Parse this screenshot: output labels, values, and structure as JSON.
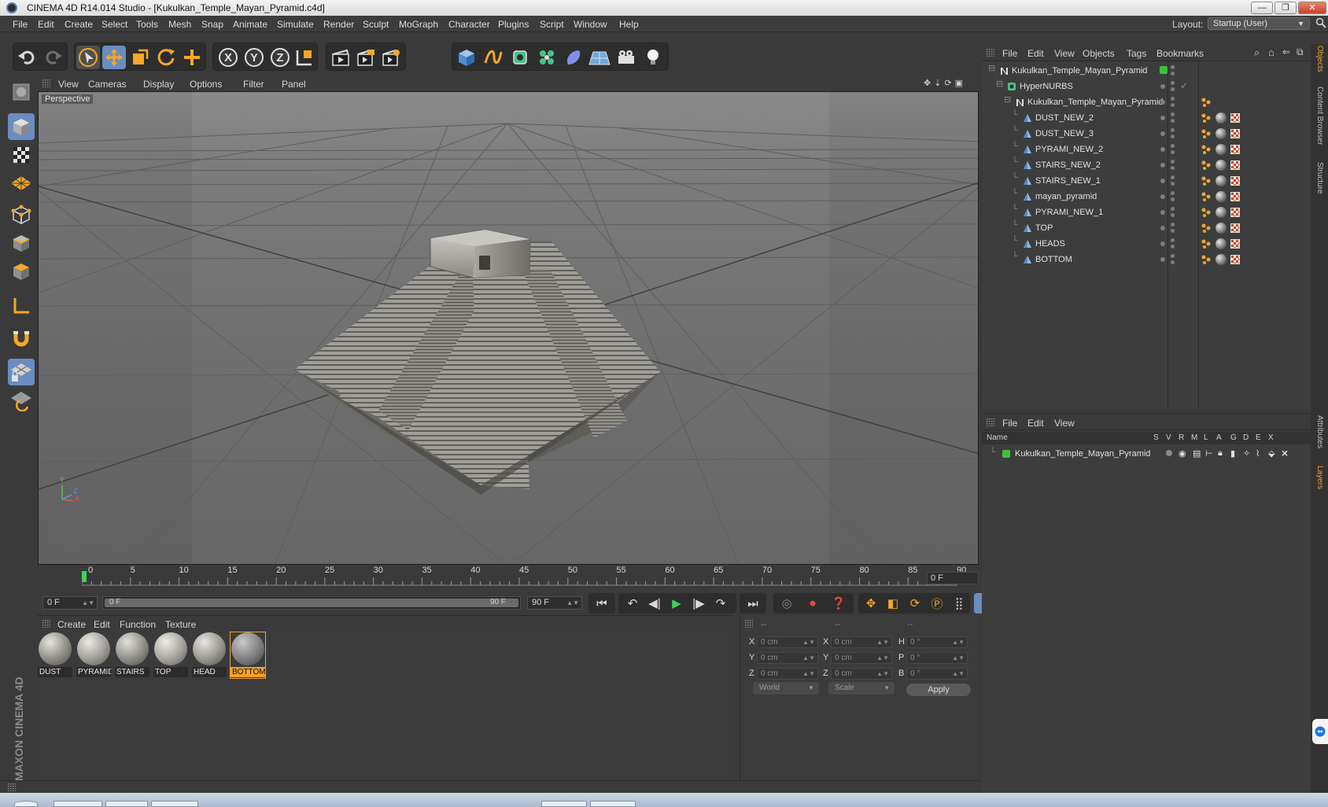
{
  "window": {
    "title": "CINEMA 4D R14.014 Studio - [Kukulkan_Temple_Mayan_Pyramid.c4d]",
    "minimize_glyph": "—",
    "restore_glyph": "❐",
    "close_glyph": "✕"
  },
  "menubar": {
    "items": [
      "File",
      "Edit",
      "Create",
      "Select",
      "Tools",
      "Mesh",
      "Snap",
      "Animate",
      "Simulate",
      "Render",
      "Sculpt",
      "MoGraph",
      "Character",
      "Plugins",
      "Script",
      "Window",
      "Help"
    ],
    "layout_label": "Layout:",
    "layout_value": "Startup (User)"
  },
  "viewport": {
    "menu": [
      "View",
      "Cameras",
      "Display",
      "Options",
      "Filter",
      "Panel"
    ],
    "label": "Perspective",
    "axis_y": "Y",
    "axis_x": "X",
    "axis_z": "Z"
  },
  "timeline": {
    "ticks": [
      "0",
      "5",
      "10",
      "15",
      "20",
      "25",
      "30",
      "35",
      "40",
      "45",
      "50",
      "55",
      "60",
      "65",
      "70",
      "75",
      "80",
      "85",
      "90"
    ],
    "current_frame": "0 F"
  },
  "transport": {
    "start_field": "0 F",
    "range_left": "0 F",
    "range_right": "90 F",
    "end_field": "90 F"
  },
  "materials": {
    "menu": [
      "Create",
      "Edit",
      "Function",
      "Texture"
    ],
    "items": [
      {
        "name": "DUST",
        "selected": false
      },
      {
        "name": "PYRAMID",
        "selected": false
      },
      {
        "name": "STAIRS",
        "selected": false
      },
      {
        "name": "TOP",
        "selected": false
      },
      {
        "name": "HEAD",
        "selected": false
      },
      {
        "name": "BOTTOM",
        "selected": true
      }
    ]
  },
  "coordinates": {
    "headers": [
      "--",
      "--",
      "--"
    ],
    "rows": [
      {
        "l1": "X",
        "v1": "0 cm",
        "l2": "X",
        "v2": "0 cm",
        "l3": "H",
        "v3": "0 °"
      },
      {
        "l1": "Y",
        "v1": "0 cm",
        "l2": "Y",
        "v2": "0 cm",
        "l3": "P",
        "v3": "0 °"
      },
      {
        "l1": "Z",
        "v1": "0 cm",
        "l2": "Z",
        "v2": "0 cm",
        "l3": "B",
        "v3": "0 °"
      }
    ],
    "space_select": "World",
    "mode_select": "Scale",
    "apply": "Apply"
  },
  "object_manager": {
    "menu": [
      "File",
      "Edit",
      "View",
      "Objects",
      "Tags",
      "Bookmarks"
    ],
    "objects": [
      {
        "name": "Kukulkan_Temple_Mayan_Pyramid",
        "depth": 0,
        "icon": "null-icon"
      },
      {
        "name": "HyperNURBS",
        "depth": 1,
        "icon": "hypernurbs-icon"
      },
      {
        "name": "Kukulkan_Temple_Mayan_Pyramid",
        "depth": 2,
        "icon": "null-icon"
      },
      {
        "name": "DUST_NEW_2",
        "depth": 3,
        "icon": "polygon-icon"
      },
      {
        "name": "DUST_NEW_3",
        "depth": 3,
        "icon": "polygon-icon"
      },
      {
        "name": "PYRAMI_NEW_2",
        "depth": 3,
        "icon": "polygon-icon"
      },
      {
        "name": "STAIRS_NEW_2",
        "depth": 3,
        "icon": "polygon-icon"
      },
      {
        "name": "STAIRS_NEW_1",
        "depth": 3,
        "icon": "polygon-icon"
      },
      {
        "name": "mayan_pyramid",
        "depth": 3,
        "icon": "polygon-icon"
      },
      {
        "name": "PYRAMI_NEW_1",
        "depth": 3,
        "icon": "polygon-icon"
      },
      {
        "name": "TOP",
        "depth": 3,
        "icon": "polygon-icon"
      },
      {
        "name": "HEADS",
        "depth": 3,
        "icon": "polygon-icon"
      },
      {
        "name": "BOTTOM",
        "depth": 3,
        "icon": "polygon-icon"
      }
    ]
  },
  "layer_manager": {
    "menu": [
      "File",
      "Edit",
      "View"
    ],
    "columns": [
      "Name",
      "S",
      "V",
      "R",
      "M",
      "L",
      "A",
      "G",
      "D",
      "E",
      "X"
    ],
    "layers": [
      {
        "name": "Kukulkan_Temple_Mayan_Pyramid",
        "color": "#3fbf3f"
      }
    ]
  },
  "side_tabs": [
    "Objects",
    "Content Browser",
    "Structure",
    "Attributes",
    "Layers"
  ],
  "branding": "MAXON CINEMA 4D",
  "colors": {
    "accent": "#f2a12a",
    "selection": "#6a8dbf",
    "layer_green": "#3fbf3f"
  }
}
